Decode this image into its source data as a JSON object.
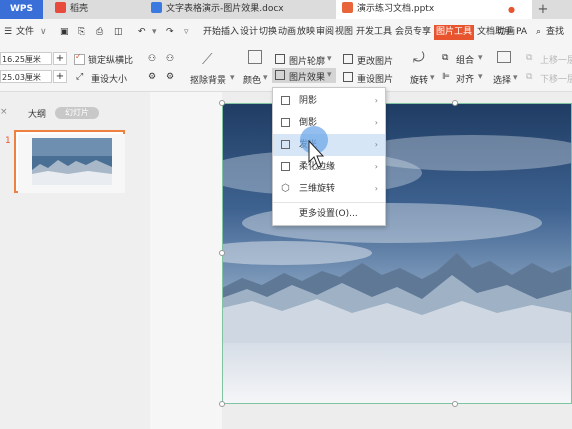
{
  "tabs": {
    "wps": "WPS",
    "tab1": "稻壳",
    "tab2": "文字表格演示-图片效果.docx",
    "tab3": "演示练习文档.pptx",
    "new": "+"
  },
  "menu": {
    "file": "文件",
    "items": [
      "开始",
      "插入",
      "设计",
      "切换",
      "动画",
      "放映",
      "审阅",
      "视图",
      "开发工具",
      "会员专享",
      "图片工具",
      "文档助手",
      "动画",
      "PA"
    ],
    "search": "查找"
  },
  "ribbon": {
    "height_value": "16.25厘米",
    "width_value": "25.03厘米",
    "lock_ratio": "锁定纵横比",
    "reset_size": "重设大小",
    "remove_bg": "抠除背景",
    "color": "颜色",
    "outline": "图片轮廓",
    "effects": "图片效果",
    "change_pic": "更改图片",
    "reset_pic": "重设图片",
    "rotate": "旋转",
    "group": "组合",
    "align": "对齐",
    "select": "选择",
    "up_layer": "上移一层",
    "down_layer": "下移一层"
  },
  "left_panel": {
    "outline_tab": "大纲",
    "slides_tab": "幻灯片",
    "slide_number": "1"
  },
  "effects_menu": {
    "items": [
      {
        "label": "阴影"
      },
      {
        "label": "倒影"
      },
      {
        "label": "发光"
      },
      {
        "label": "柔化边缘"
      },
      {
        "label": "三维旋转"
      }
    ],
    "more": "更多设置(O)..."
  },
  "colors": {
    "accent": "#e8542e",
    "wps_blue": "#3a6fd8",
    "hover": "#d6e6f7",
    "thumb_border": "#ee8040"
  }
}
